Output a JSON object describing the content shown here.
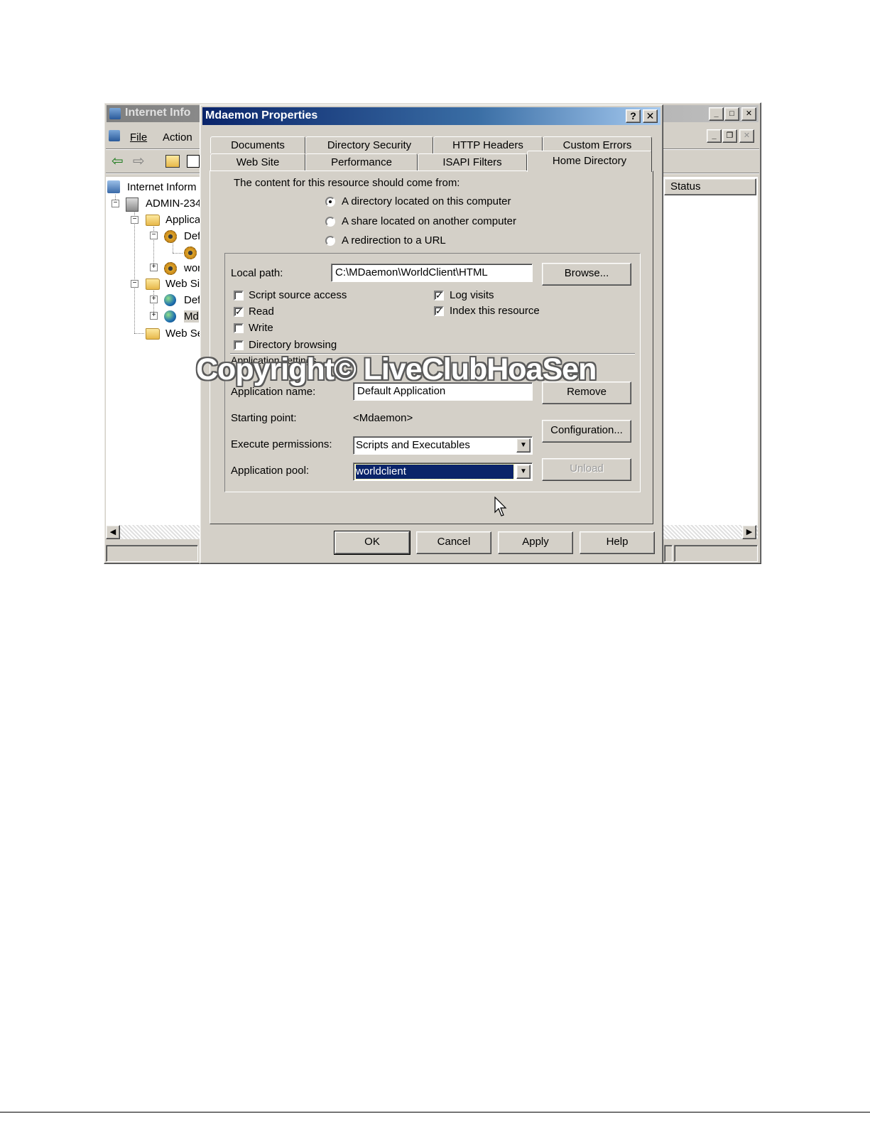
{
  "mmc": {
    "title": "Internet Info",
    "menu": {
      "file": "File",
      "action": "Action"
    },
    "tree": {
      "root": "Internet Inform",
      "server": "ADMIN-234",
      "app_pools": "Applica",
      "pool_default": "Def",
      "pool_world": "wor",
      "web_sites": "Web Sit",
      "site_default": "Def",
      "site_mdaemon": "Md",
      "web_ext": "Web Se"
    },
    "column_status": "Status"
  },
  "dialog": {
    "title": "Mdaemon Properties",
    "help_btn": "?",
    "close_btn": "✕",
    "tabs_row1": [
      "Documents",
      "Directory Security",
      "HTTP Headers",
      "Custom Errors"
    ],
    "tabs_row2": [
      "Web Site",
      "Performance",
      "ISAPI Filters",
      "Home Directory"
    ],
    "active_tab": "Home Directory",
    "content_prompt": "The content for this resource should come from:",
    "radio_options": [
      "A directory located on this computer",
      "A share located on another computer",
      "A redirection to a URL"
    ],
    "selected_radio": 0,
    "local_path_label": "Local path:",
    "local_path_value": "C:\\MDaemon\\WorldClient\\HTML",
    "browse_label": "Browse...",
    "checkboxes_left": [
      {
        "label": "Script source access",
        "checked": false
      },
      {
        "label": "Read",
        "checked": true
      },
      {
        "label": "Write",
        "checked": false
      },
      {
        "label": "Directory browsing",
        "checked": false
      }
    ],
    "checkboxes_right": [
      {
        "label": "Log visits",
        "checked": true
      },
      {
        "label": "Index this resource",
        "checked": true
      }
    ],
    "app_settings_group": "Application settings",
    "app_name_label": "Application name:",
    "app_name_value": "Default Application",
    "remove_label": "Remove",
    "starting_point_label": "Starting point:",
    "starting_point_value": "<Mdaemon>",
    "configuration_label": "Configuration...",
    "execute_label": "Execute permissions:",
    "execute_value": "Scripts and Executables",
    "pool_label": "Application pool:",
    "pool_value": "worldclient",
    "unload_label": "Unload",
    "ok_label": "OK",
    "cancel_label": "Cancel",
    "apply_label": "Apply",
    "help_label": "Help"
  },
  "watermark": "Copyright© LiveClubHoaSen",
  "colors": {
    "titlebar_active": "#0a246a",
    "titlebar_inactive": "#808080",
    "face": "#d4d0c8",
    "selection": "#0a246a"
  }
}
